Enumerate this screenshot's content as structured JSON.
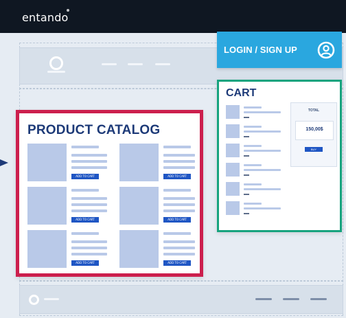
{
  "app": {
    "brand": "entando"
  },
  "login": {
    "label": "LOGIN / SIGN UP",
    "icon": "user-circle-icon"
  },
  "catalog": {
    "title": "PRODUCT CATALOG",
    "products": [
      {
        "button": "ADD TO CART"
      },
      {
        "button": "ADD TO CART"
      },
      {
        "button": "ADD TO CART"
      },
      {
        "button": "ADD TO CART"
      },
      {
        "button": "ADD TO CART"
      },
      {
        "button": "ADD TO CART"
      }
    ]
  },
  "cart": {
    "title": "CART",
    "total_label": "TOTAL",
    "total_value": "150,00$",
    "buy_button": "BUY",
    "items_count": 6
  },
  "colors": {
    "topbar": "#0f1722",
    "login_bg": "#2aa7df",
    "catalog_border": "#cc1f4d",
    "cart_border": "#17a37e",
    "title_blue": "#1d3a78",
    "button_blue": "#1f56c4"
  }
}
